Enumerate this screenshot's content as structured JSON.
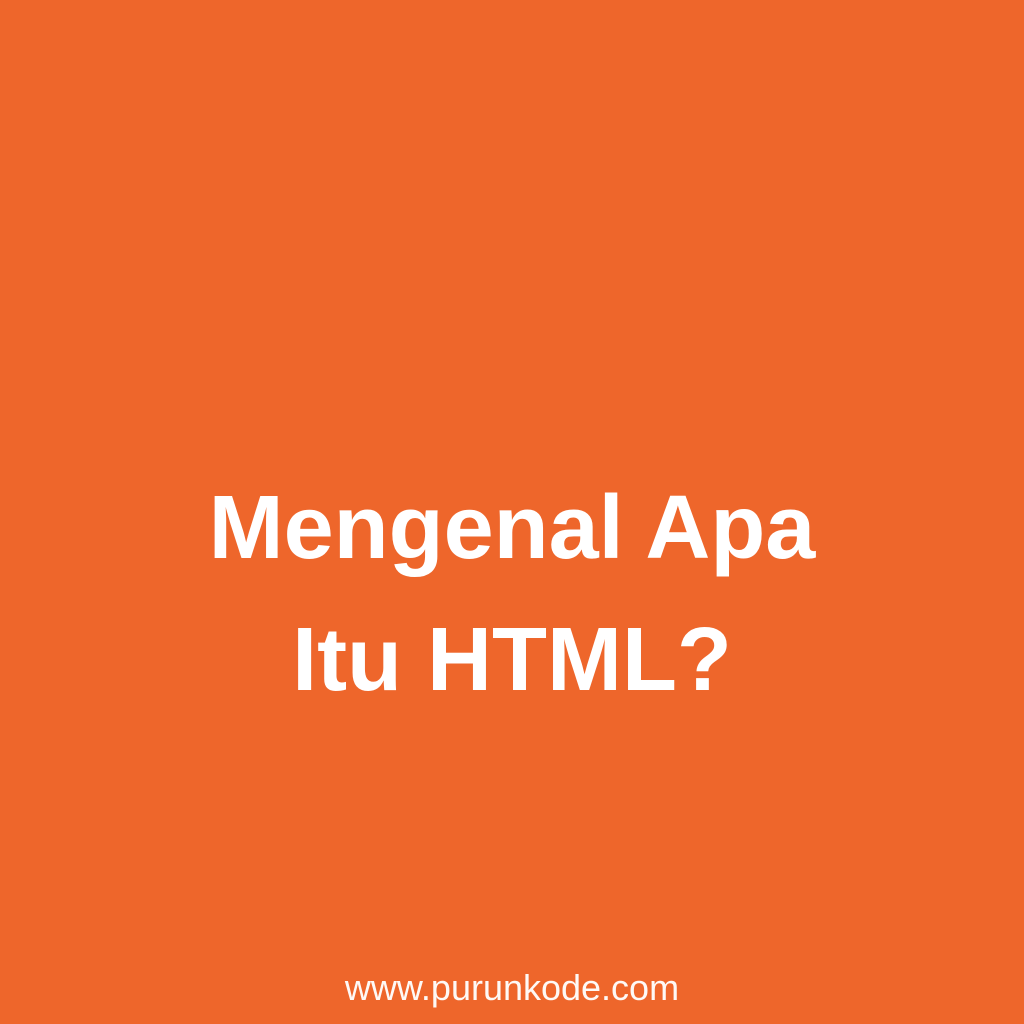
{
  "background_color": "#ee662b",
  "text_color": "#ffffff",
  "title": {
    "line1": "Mengenal Apa",
    "line2": "Itu HTML?"
  },
  "footer": {
    "url": "www.purunkode.com"
  }
}
